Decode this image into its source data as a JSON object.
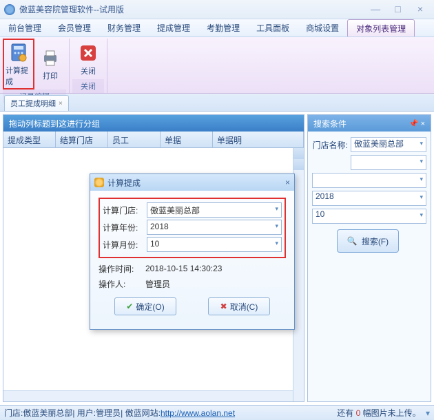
{
  "window": {
    "title": "傲蓝美容院管理软件--试用版"
  },
  "menu": {
    "items": [
      "前台管理",
      "会员管理",
      "财务管理",
      "提成管理",
      "考勤管理",
      "工具面板",
      "商城设置",
      "对象列表管理"
    ],
    "active_index": 7
  },
  "ribbon": {
    "groups": [
      {
        "label": "记录编辑",
        "buttons": [
          {
            "name": "calc-commission",
            "label": "计算提成",
            "highlight": true
          },
          {
            "name": "print",
            "label": "打印"
          }
        ]
      },
      {
        "label": "关闭",
        "buttons": [
          {
            "name": "close",
            "label": "关闭"
          }
        ]
      }
    ]
  },
  "doctab": {
    "label": "员工提成明细"
  },
  "grid": {
    "grouptext": "拖动列标题到这进行分组",
    "columns": [
      "提成类型",
      "结算门店",
      "员工",
      "单据",
      "单据明"
    ]
  },
  "side": {
    "title": "搜索条件",
    "fields": {
      "store_label": "门店名称:",
      "store_value": "傲蓝美丽总部",
      "blank_label1": "",
      "blank_value1": "",
      "blank_value2": "",
      "year_value": "2018",
      "month_value": "10"
    },
    "search_btn": "搜索(F)"
  },
  "dialog": {
    "title": "计算提成",
    "store_label": "计算门店:",
    "store_value": "傲蓝美丽总部",
    "year_label": "计算年份:",
    "year_value": "2018",
    "month_label": "计算月份:",
    "month_value": "10",
    "optime_label": "操作时间:",
    "optime_value": "2018-10-15 14:30:23",
    "operator_label": "操作人:",
    "operator_value": "管理员",
    "ok": "确定(O)",
    "cancel": "取消(C)"
  },
  "status": {
    "store_prefix": "门店: ",
    "store": "傲蓝美丽总部",
    "user_prefix": " | 用户: ",
    "user": "管理员",
    "site_prefix": " | 傲蓝网站: ",
    "url": "http://www.aolan.net",
    "right_prefix": "还有 ",
    "right_count": "0",
    "right_suffix": " 幅图片未上传。"
  }
}
